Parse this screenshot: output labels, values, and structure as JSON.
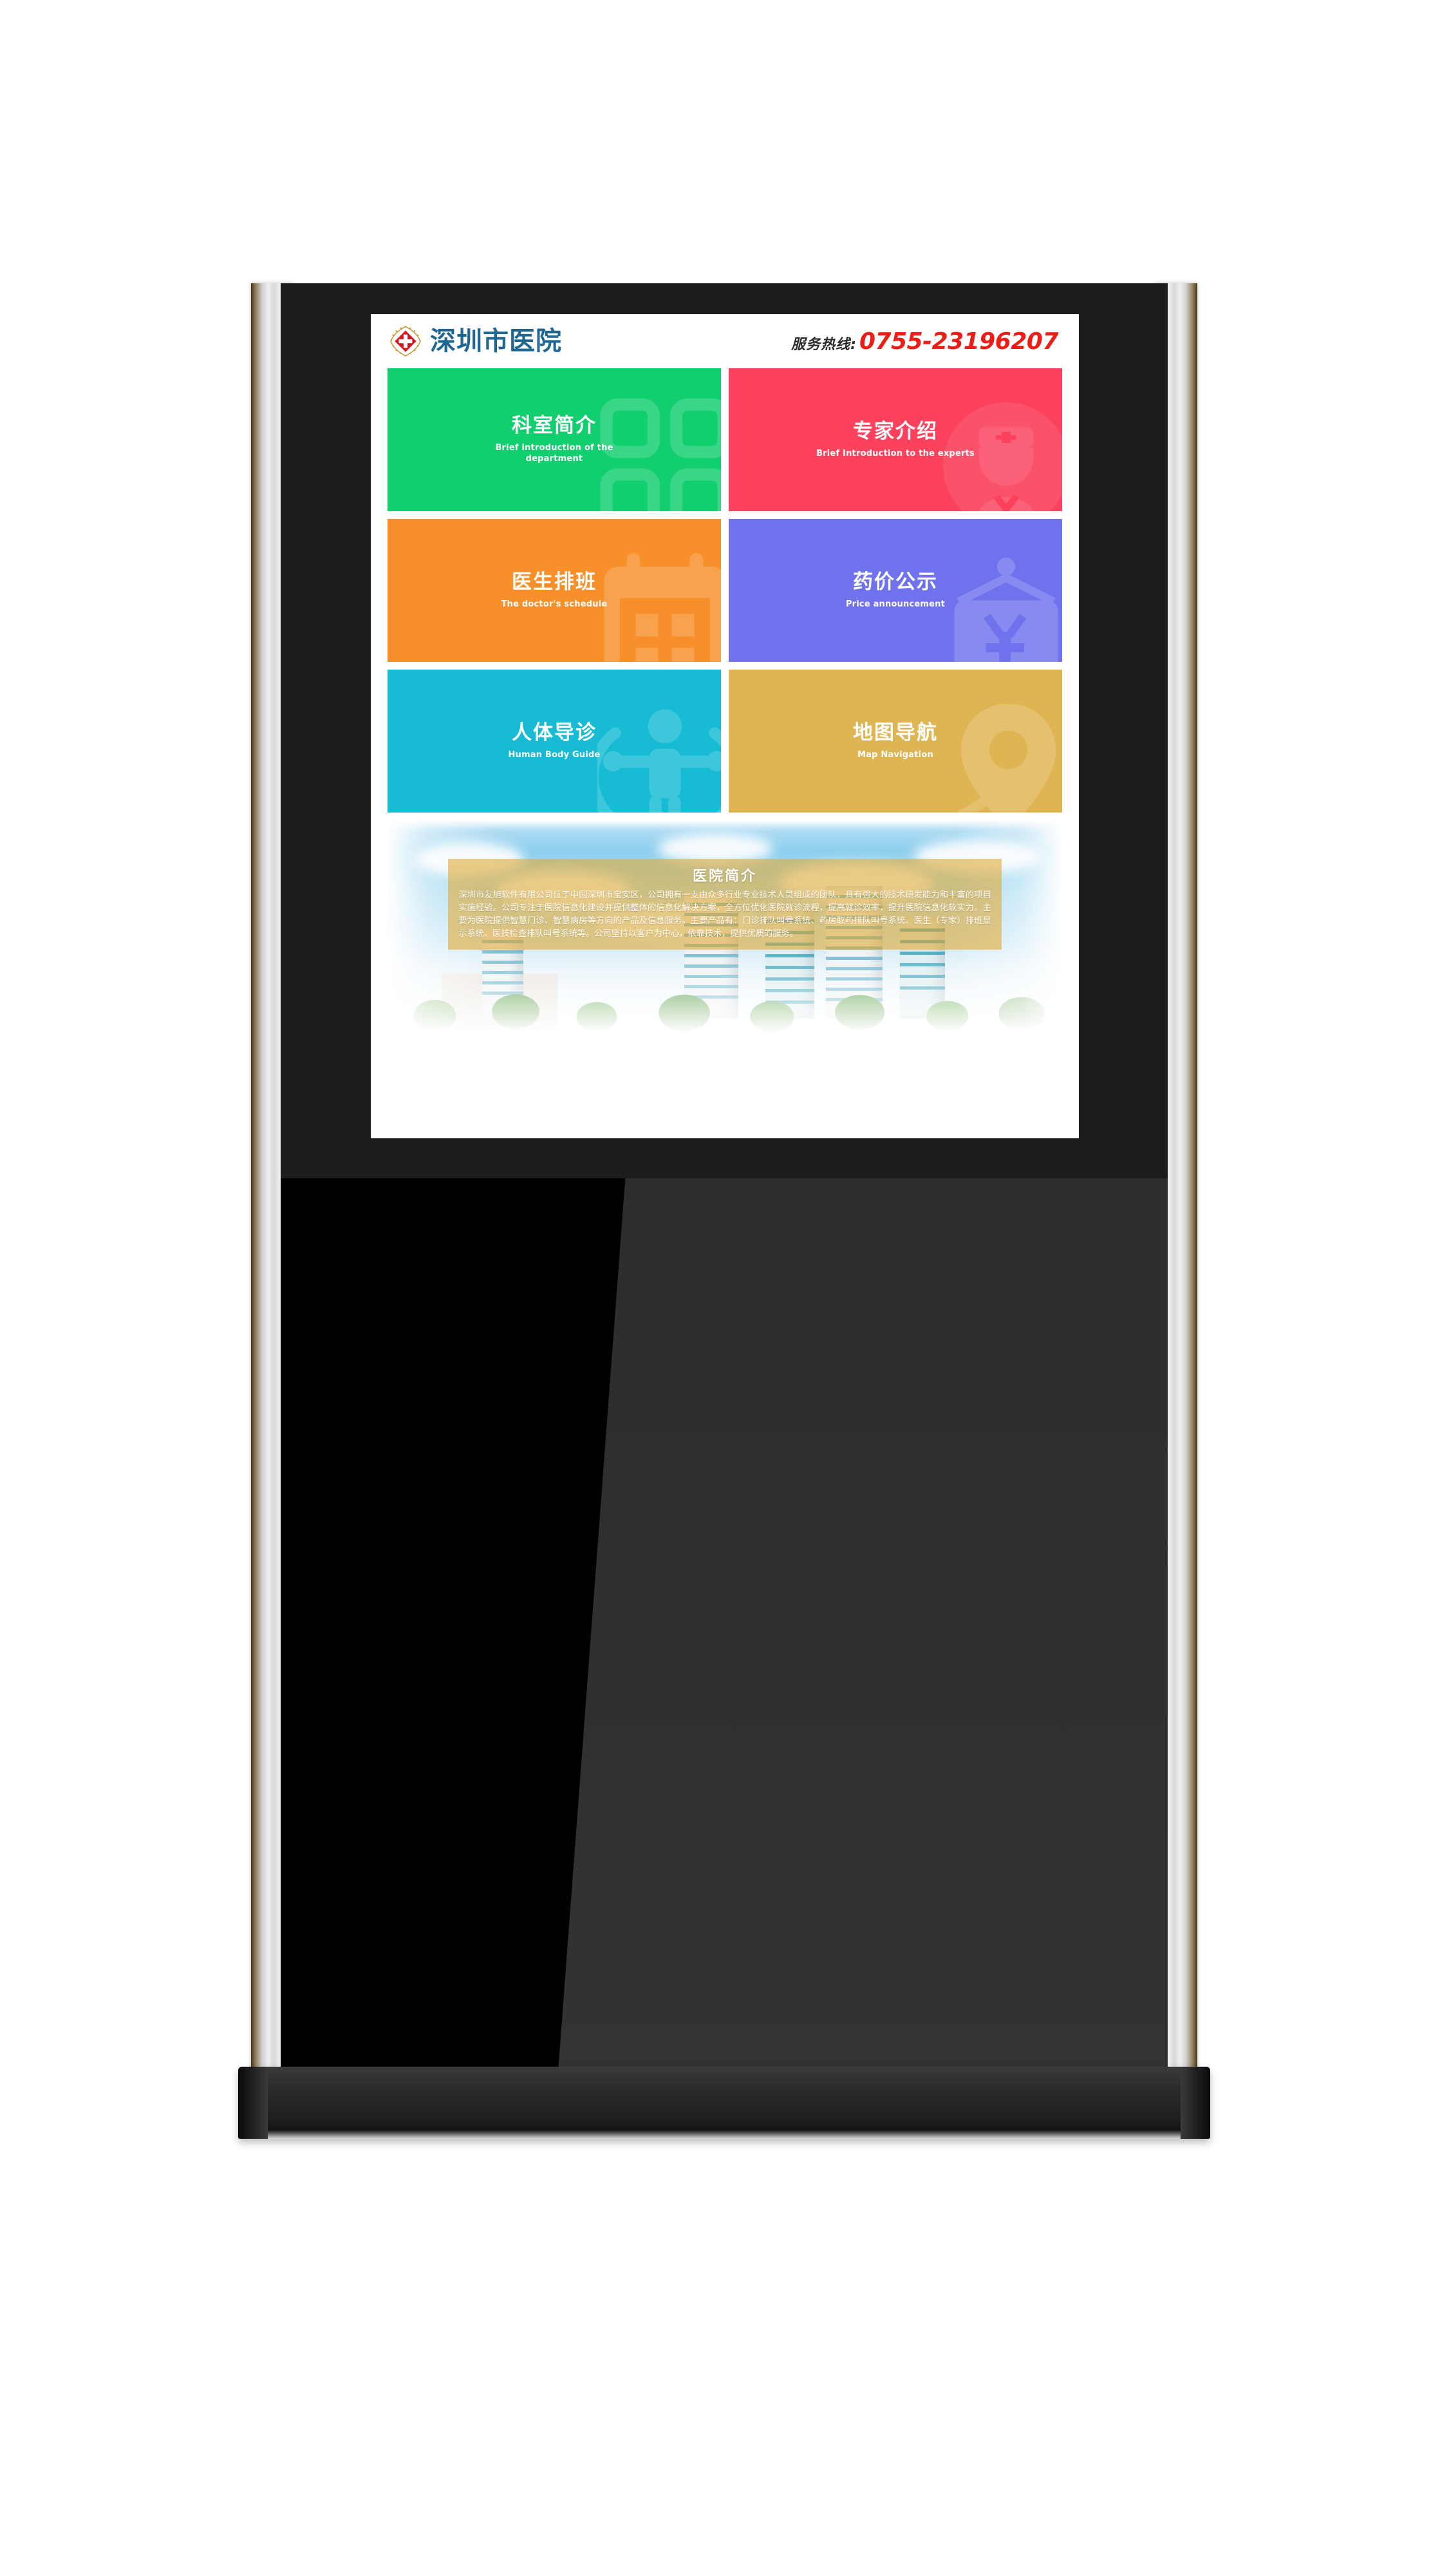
{
  "header": {
    "logo_icon": "red-cross-emblem-icon",
    "hospital_name": "深圳市医院",
    "hotline_label": "服务热线:",
    "hotline_number": "0755-23196207"
  },
  "tiles": [
    {
      "title": "科室简介",
      "subtitle": "Brief introduction of the department",
      "color": "#11ce6f",
      "icon": "department-building-icon"
    },
    {
      "title": "专家介绍",
      "subtitle": "Brief Introduction to the experts",
      "color": "#fb415c",
      "icon": "doctor-avatar-icon"
    },
    {
      "title": "医生排班",
      "subtitle": "The doctor's schedule",
      "color": "#f78f2a",
      "icon": "calendar-icon"
    },
    {
      "title": "药价公示",
      "subtitle": "Price announcement",
      "color": "#6f72ec",
      "icon": "price-board-yuan-icon"
    },
    {
      "title": "人体导诊",
      "subtitle": "Human Body Guide",
      "color": "#17bcd4",
      "icon": "human-body-icon"
    },
    {
      "title": "地图导航",
      "subtitle": "Map Navigation",
      "color": "#dfb452",
      "icon": "map-pin-icon"
    }
  ],
  "intro": {
    "title": "医院简介",
    "body": "深圳市友旭软件有限公司位于中国深圳市宝安区，公司拥有一支由众多行业专业技术人员组成的团队，具有强大的技术研发能力和丰富的项目实施经验。公司专注于医院信息化建设并提供整体的信息化解决方案，全方位优化医院就诊流程，提高就诊效率，提升医院信息化软实力。主要为医院提供智慧门诊、智慧病房等方向的产品及信息服务。主要产品有：门诊排队叫号系统、药房取药排队叫号系统、医生（专家）排班显示系统、医技检查排队叫号系统等。公司坚持以客户为中心，依靠技术，提供优质的服务。"
  },
  "device": {
    "type": "floor-standing-digital-signage-kiosk",
    "bezel_color": "#1c1c1c",
    "body_color": "#2e2e2e",
    "rail_finish": "brushed-silver-gold-edge"
  }
}
